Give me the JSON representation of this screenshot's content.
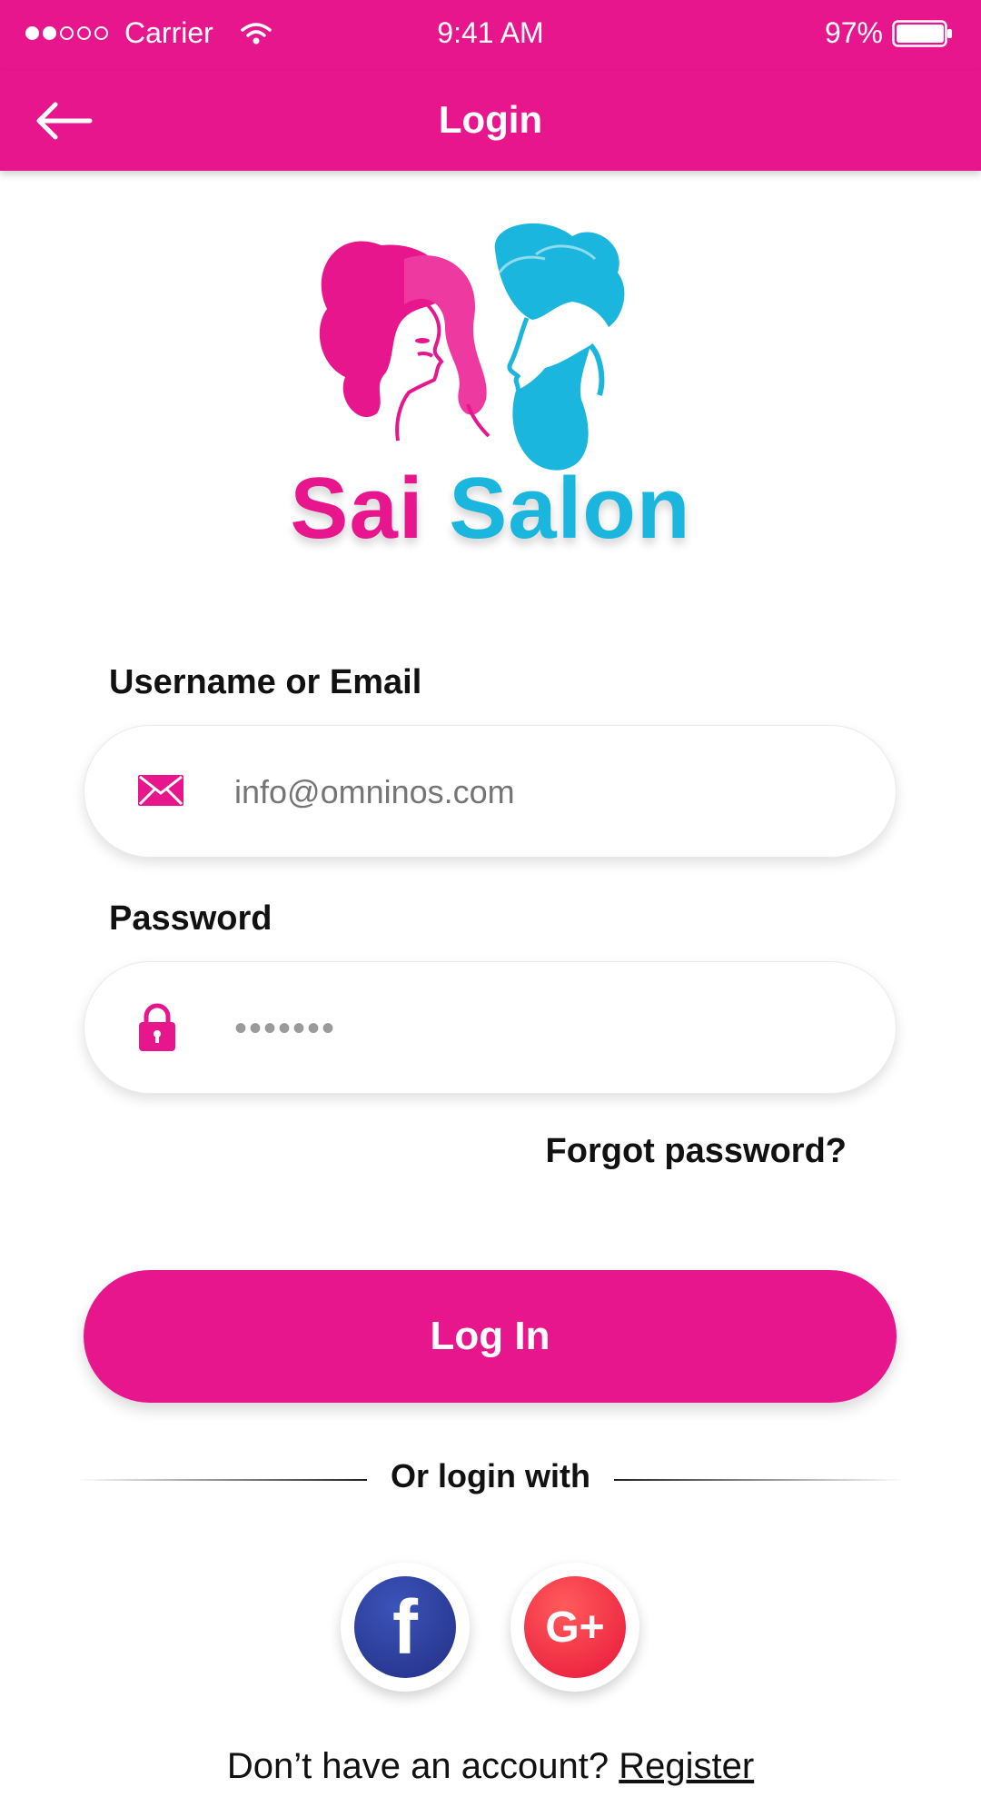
{
  "status_bar": {
    "carrier": "Carrier",
    "time": "9:41 AM",
    "battery": "97%",
    "icons": [
      "signal-icon",
      "wifi-icon",
      "battery-icon"
    ]
  },
  "nav": {
    "title": "Login",
    "back_icon": "arrow-left-icon"
  },
  "brand": {
    "word1": "Sai",
    "word2": "Salon",
    "logo_icon": "salon-logo"
  },
  "form": {
    "username": {
      "label": "Username or Email",
      "placeholder": "info@omninos.com",
      "icon": "envelope-icon"
    },
    "password": {
      "label": "Password",
      "masked_value": "•••••••",
      "icon": "lock-icon"
    },
    "forgot_label": "Forgot password?",
    "login_label": "Log In"
  },
  "social": {
    "divider_text": "Or login with",
    "facebook_glyph": "f",
    "google_glyph": "G+"
  },
  "register": {
    "prompt": "Don’t have an account?",
    "link": "Register"
  },
  "colors": {
    "primary": "#e8168c",
    "secondary": "#1bb6dd",
    "facebook": "#2a3a99",
    "google": "#f0253f"
  }
}
